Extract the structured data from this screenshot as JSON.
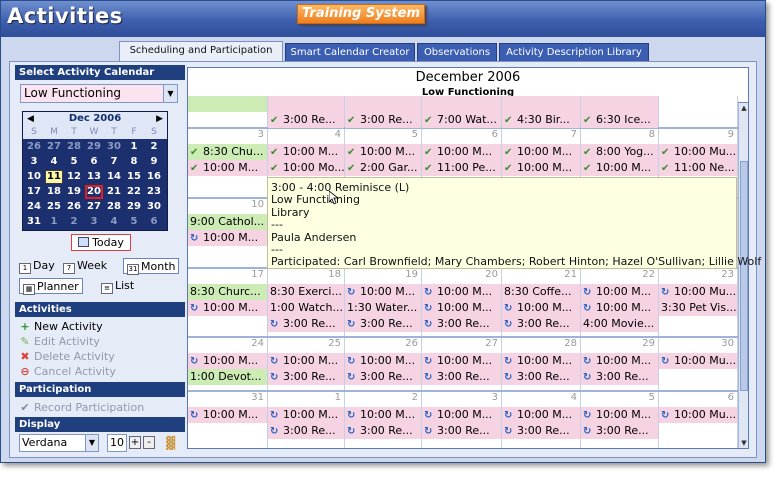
{
  "app": {
    "title": "Activities",
    "brand": "Training System"
  },
  "tabs": [
    {
      "label": "Scheduling and Participation"
    },
    {
      "label": "Smart Calendar Creator"
    },
    {
      "label": "Observations"
    },
    {
      "label": "Activity Description Library"
    }
  ],
  "sidebar": {
    "select_header": "Select Activity Calendar",
    "calendar_value": "Low Functioning",
    "mini": {
      "month": "Dec 2006",
      "dow": [
        "S",
        "M",
        "T",
        "W",
        "T",
        "F",
        "S"
      ],
      "weeks": [
        [
          "26",
          "27",
          "28",
          "29",
          "30",
          "1",
          "2"
        ],
        [
          "3",
          "4",
          "5",
          "6",
          "7",
          "8",
          "9"
        ],
        [
          "10",
          "11",
          "12",
          "13",
          "14",
          "15",
          "16"
        ],
        [
          "17",
          "18",
          "19",
          "20",
          "21",
          "22",
          "23"
        ],
        [
          "24",
          "25",
          "26",
          "27",
          "28",
          "29",
          "30"
        ],
        [
          "31",
          "1",
          "2",
          "3",
          "4",
          "5",
          "6"
        ]
      ]
    },
    "today_label": "Today",
    "views": {
      "day": "Day",
      "week": "Week",
      "month": "Month",
      "planner": "Planner",
      "list": "List"
    },
    "activities_header": "Activities",
    "activities": {
      "new": "New Activity",
      "edit": "Edit Activity",
      "delete": "Delete Activity",
      "cancel": "Cancel Activity"
    },
    "participation_header": "Participation",
    "record_participation": "Record Participation",
    "display_header": "Display",
    "font": "Verdana",
    "font_size": "10"
  },
  "calendar": {
    "month_title": "December 2006",
    "calendar_title": "Low Functioning",
    "weeks": [
      {
        "days": [
          {
            "num": "",
            "events": [
              {
                "t": "",
                "c": "gn",
                "i": ""
              },
              {
                "t": "",
                "c": "",
                "i": ""
              }
            ]
          },
          {
            "num": "",
            "events": [
              {
                "t": "",
                "c": "pk",
                "i": ""
              },
              {
                "t": "3:00 Re...",
                "c": "pk",
                "i": "chk"
              }
            ]
          },
          {
            "num": "",
            "events": [
              {
                "t": "",
                "c": "pk",
                "i": ""
              },
              {
                "t": "3:00 Re...",
                "c": "pk",
                "i": "chk"
              }
            ]
          },
          {
            "num": "",
            "events": [
              {
                "t": "",
                "c": "pk",
                "i": ""
              },
              {
                "t": "7:00 Wat...",
                "c": "pk",
                "i": "chk"
              }
            ]
          },
          {
            "num": "",
            "events": [
              {
                "t": "",
                "c": "pk",
                "i": ""
              },
              {
                "t": "4:30 Bir...",
                "c": "pk",
                "i": "chk"
              }
            ]
          },
          {
            "num": "",
            "events": [
              {
                "t": "",
                "c": "pk",
                "i": ""
              },
              {
                "t": "6:30 Ice...",
                "c": "pk",
                "i": "chk"
              }
            ]
          },
          {
            "num": "",
            "events": [
              {
                "t": "",
                "c": "",
                "i": ""
              }
            ]
          }
        ]
      },
      {
        "days": [
          {
            "num": "3",
            "events": [
              {
                "t": "8:30 Chu...",
                "c": "gn",
                "i": "chk"
              },
              {
                "t": "10:00 M...",
                "c": "pk",
                "i": "chk"
              }
            ]
          },
          {
            "num": "4",
            "events": [
              {
                "t": "10:00 M...",
                "c": "pk",
                "i": "chk"
              },
              {
                "t": "10:00 Mo...",
                "c": "pk",
                "i": "chk"
              }
            ]
          },
          {
            "num": "5",
            "events": [
              {
                "t": "10:00 M...",
                "c": "pk",
                "i": "chk"
              },
              {
                "t": "2:00 Gar...",
                "c": "pk",
                "i": "chk"
              }
            ]
          },
          {
            "num": "6",
            "events": [
              {
                "t": "10:00 M...",
                "c": "pk",
                "i": "chk"
              },
              {
                "t": "11:00 Pe...",
                "c": "pk",
                "i": "chk"
              }
            ]
          },
          {
            "num": "7",
            "events": [
              {
                "t": "10:00 M...",
                "c": "pk",
                "i": "chk"
              },
              {
                "t": "10:00 M...",
                "c": "pk",
                "i": "chk"
              }
            ]
          },
          {
            "num": "8",
            "events": [
              {
                "t": "8:00 Yog...",
                "c": "pk",
                "i": "chk"
              },
              {
                "t": "10:00 M...",
                "c": "pk",
                "i": "chk"
              }
            ]
          },
          {
            "num": "9",
            "events": [
              {
                "t": "10:00 Mu...",
                "c": "pk",
                "i": "chk"
              },
              {
                "t": "11:00 Ne...",
                "c": "pk",
                "i": "chk"
              }
            ]
          }
        ]
      },
      {
        "days": [
          {
            "num": "10",
            "events": [
              {
                "t": "9:00 Cathol...",
                "c": "gn",
                "i": ""
              },
              {
                "t": "10:00 M...",
                "c": "pk",
                "i": "c"
              }
            ]
          },
          {
            "num": "",
            "events": []
          },
          {
            "num": "",
            "events": []
          },
          {
            "num": "",
            "events": []
          },
          {
            "num": "",
            "events": []
          },
          {
            "num": "",
            "events": []
          },
          {
            "num": "",
            "events": []
          }
        ]
      },
      {
        "days": [
          {
            "num": "17",
            "events": [
              {
                "t": "8:30 Churc...",
                "c": "gn",
                "i": ""
              },
              {
                "t": "10:00 M...",
                "c": "pk",
                "i": "c"
              }
            ]
          },
          {
            "num": "18",
            "events": [
              {
                "t": "8:30 Exerci...",
                "c": "pk",
                "i": ""
              },
              {
                "t": "1:00 Watch...",
                "c": "pk",
                "i": ""
              },
              {
                "t": "3:00 Re...",
                "c": "pk",
                "i": "c"
              }
            ]
          },
          {
            "num": "19",
            "events": [
              {
                "t": "10:00 M...",
                "c": "pk",
                "i": "c"
              },
              {
                "t": "1:30 Water...",
                "c": "pk",
                "i": ""
              },
              {
                "t": "3:00 Re...",
                "c": "pk",
                "i": "c"
              }
            ]
          },
          {
            "num": "20",
            "events": [
              {
                "t": "10:00 M...",
                "c": "pk",
                "i": "c"
              },
              {
                "t": "10:00 M...",
                "c": "pk",
                "i": "c"
              },
              {
                "t": "3:00 Re...",
                "c": "pk",
                "i": "c"
              }
            ]
          },
          {
            "num": "21",
            "events": [
              {
                "t": "8:30 Coffe...",
                "c": "pk",
                "i": ""
              },
              {
                "t": "10:00 M...",
                "c": "pk",
                "i": "c"
              },
              {
                "t": "3:00 Re...",
                "c": "pk",
                "i": "c"
              }
            ]
          },
          {
            "num": "22",
            "events": [
              {
                "t": "10:00 M...",
                "c": "pk",
                "i": "c"
              },
              {
                "t": "10:00 M...",
                "c": "pk",
                "i": "c"
              },
              {
                "t": "4:00 Movie...",
                "c": "pk",
                "i": ""
              }
            ]
          },
          {
            "num": "23",
            "events": [
              {
                "t": "10:00 Mu...",
                "c": "pk",
                "i": "c"
              },
              {
                "t": "3:30 Pet Vis...",
                "c": "pk",
                "i": ""
              }
            ]
          }
        ]
      },
      {
        "days": [
          {
            "num": "24",
            "events": [
              {
                "t": "10:00 M...",
                "c": "pk",
                "i": "c"
              },
              {
                "t": "1:00 Devot...",
                "c": "gn",
                "i": ""
              }
            ]
          },
          {
            "num": "25",
            "events": [
              {
                "t": "10:00 M...",
                "c": "pk",
                "i": "c"
              },
              {
                "t": "3:00 Re...",
                "c": "pk",
                "i": "c"
              }
            ]
          },
          {
            "num": "26",
            "events": [
              {
                "t": "10:00 M...",
                "c": "pk",
                "i": "c"
              },
              {
                "t": "3:00 Re...",
                "c": "pk",
                "i": "c"
              }
            ]
          },
          {
            "num": "27",
            "events": [
              {
                "t": "10:00 M...",
                "c": "pk",
                "i": "c"
              },
              {
                "t": "3:00 Re...",
                "c": "pk",
                "i": "c"
              }
            ]
          },
          {
            "num": "28",
            "events": [
              {
                "t": "10:00 M...",
                "c": "pk",
                "i": "c"
              },
              {
                "t": "3:00 Re...",
                "c": "pk",
                "i": "c"
              }
            ]
          },
          {
            "num": "29",
            "events": [
              {
                "t": "10:00 M...",
                "c": "pk",
                "i": "c"
              },
              {
                "t": "3:00 Re...",
                "c": "pk",
                "i": "c"
              }
            ]
          },
          {
            "num": "30",
            "events": [
              {
                "t": "10:00 Mu...",
                "c": "pk",
                "i": "c"
              }
            ]
          }
        ]
      },
      {
        "days": [
          {
            "num": "31",
            "events": [
              {
                "t": "10:00 M...",
                "c": "pk",
                "i": "c"
              }
            ]
          },
          {
            "num": "1",
            "events": [
              {
                "t": "10:00 M...",
                "c": "pk",
                "i": "c"
              },
              {
                "t": "3:00 Re...",
                "c": "pk",
                "i": "c"
              }
            ]
          },
          {
            "num": "2",
            "events": [
              {
                "t": "10:00 M...",
                "c": "pk",
                "i": "c"
              },
              {
                "t": "3:00 Re...",
                "c": "pk",
                "i": "c"
              }
            ]
          },
          {
            "num": "3",
            "events": [
              {
                "t": "10:00 M...",
                "c": "pk",
                "i": "c"
              },
              {
                "t": "3:00 Re...",
                "c": "pk",
                "i": "c"
              }
            ]
          },
          {
            "num": "4",
            "events": [
              {
                "t": "10:00 M...",
                "c": "pk",
                "i": "c"
              },
              {
                "t": "3:00 Re...",
                "c": "pk",
                "i": "c"
              }
            ]
          },
          {
            "num": "5",
            "events": [
              {
                "t": "10:00 M...",
                "c": "pk",
                "i": "c"
              },
              {
                "t": "3:00 Re...",
                "c": "pk",
                "i": "c"
              }
            ]
          },
          {
            "num": "6",
            "events": [
              {
                "t": "10:00 Mu...",
                "c": "pk",
                "i": "c"
              }
            ]
          }
        ]
      }
    ]
  },
  "tooltip": {
    "lines": [
      "3:00 - 4:00 Reminisce (L)",
      "Low Functioning",
      "Library",
      "---",
      "Paula Andersen",
      "---",
      "Participated: Carl Brownfield; Mary Chambers; Robert Hinton; Hazel O'Sullivan; Lillie Wolf"
    ]
  },
  "colors": {
    "event_pink": "#f6d3e2",
    "event_green": "#cdebb5",
    "header_blue": "#1f3f7f",
    "titlebar": "#3e5fae"
  }
}
